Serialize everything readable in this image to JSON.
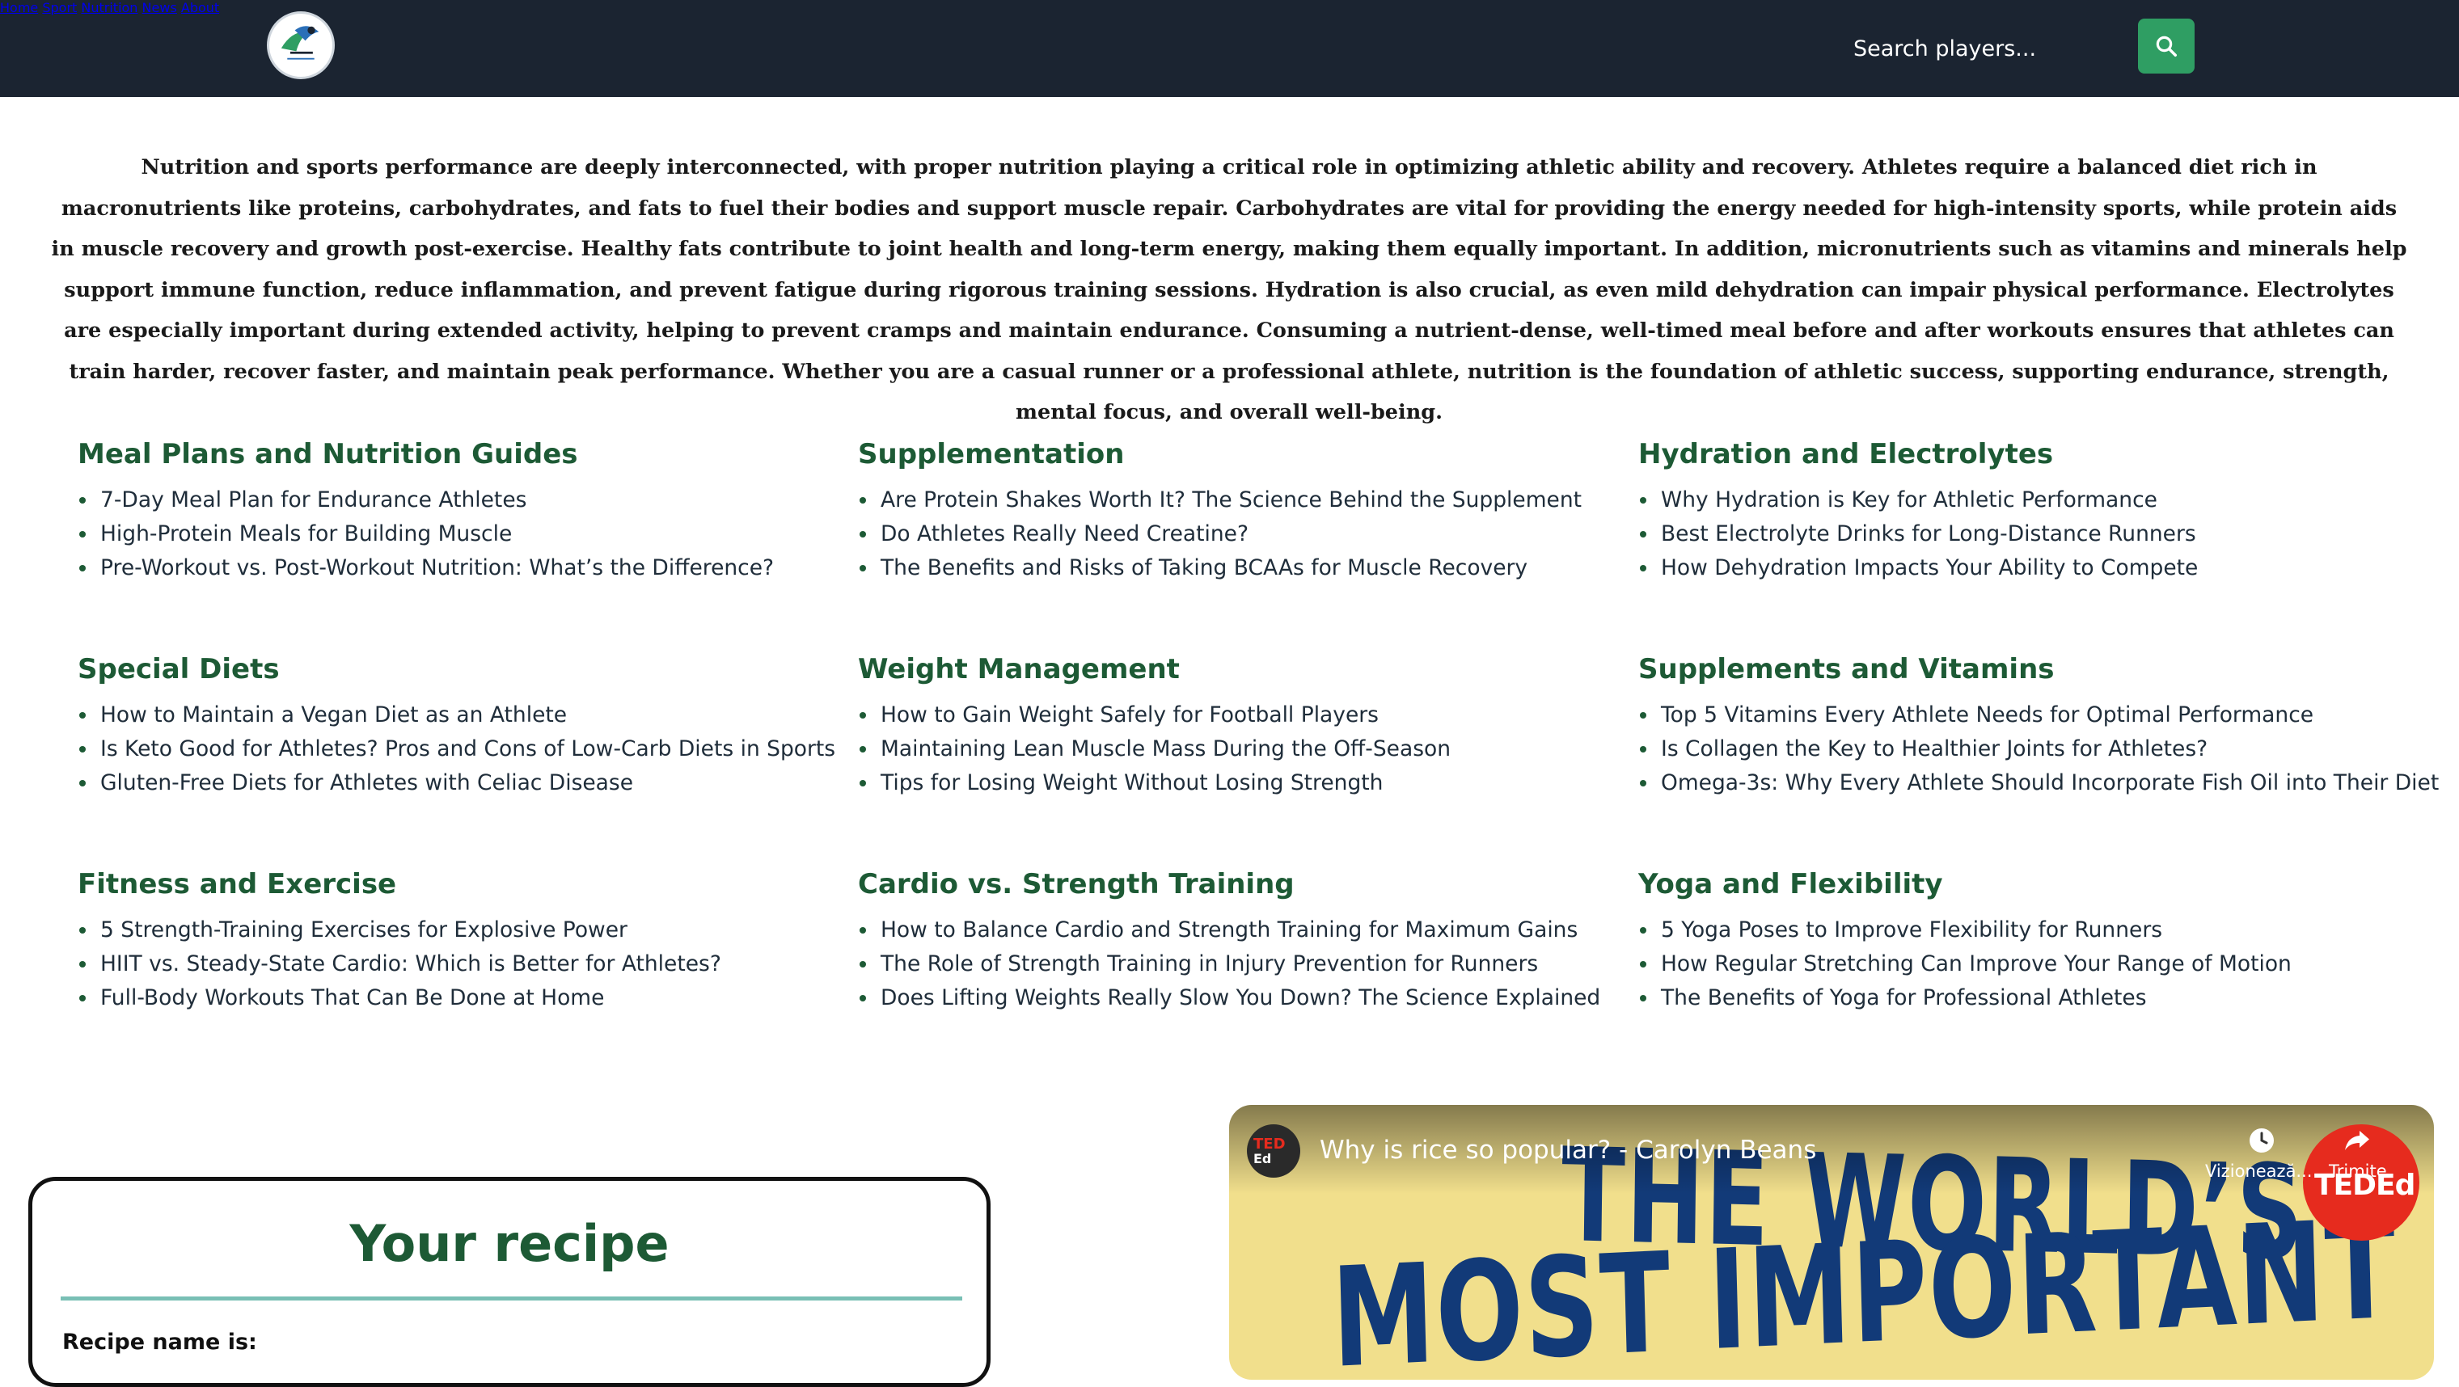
{
  "nav": {
    "links": [
      "Home",
      "Sport",
      "Nutrition",
      "News",
      "About"
    ],
    "search_placeholder": "Search players...",
    "logo_text": "SPORT & NUTRITION"
  },
  "intro": "Nutrition and sports performance are deeply interconnected, with proper nutrition playing a critical role in optimizing athletic ability and recovery. Athletes require a balanced diet rich in macronutrients like proteins, carbohydrates, and fats to fuel their bodies and support muscle repair. Carbohydrates are vital for providing the energy needed for high-intensity sports, while protein aids in muscle recovery and growth post-exercise. Healthy fats contribute to joint health and long-term energy, making them equally important. In addition, micronutrients such as vitamins and minerals help support immune function, reduce inflammation, and prevent fatigue during rigorous training sessions. Hydration is also crucial, as even mild dehydration can impair physical performance. Electrolytes are especially important during extended activity, helping to prevent cramps and maintain endurance. Consuming a nutrient-dense, well-timed meal before and after workouts ensures that athletes can train harder, recover faster, and maintain peak performance. Whether you are a casual runner or a professional athlete, nutrition is the foundation of athletic success, supporting endurance, strength, mental focus, and overall well-being.",
  "categories": [
    {
      "title": "Meal Plans and Nutrition Guides",
      "items": [
        "7-Day Meal Plan for Endurance Athletes",
        "High-Protein Meals for Building Muscle",
        "Pre-Workout vs. Post-Workout Nutrition: What’s the Difference?"
      ]
    },
    {
      "title": "Supplementation",
      "items": [
        "Are Protein Shakes Worth It? The Science Behind the Supplement",
        "Do Athletes Really Need Creatine?",
        "The Benefits and Risks of Taking BCAAs for Muscle Recovery"
      ]
    },
    {
      "title": "Hydration and Electrolytes",
      "items": [
        "Why Hydration is Key for Athletic Performance",
        "Best Electrolyte Drinks for Long-Distance Runners",
        "How Dehydration Impacts Your Ability to Compete"
      ]
    },
    {
      "title": "Special Diets",
      "items": [
        "How to Maintain a Vegan Diet as an Athlete",
        "Is Keto Good for Athletes? Pros and Cons of Low-Carb Diets in Sports",
        "Gluten-Free Diets for Athletes with Celiac Disease"
      ]
    },
    {
      "title": "Weight Management",
      "items": [
        "How to Gain Weight Safely for Football Players",
        "Maintaining Lean Muscle Mass During the Off-Season",
        "Tips for Losing Weight Without Losing Strength"
      ]
    },
    {
      "title": "Supplements and Vitamins",
      "items": [
        "Top 5 Vitamins Every Athlete Needs for Optimal Performance",
        "Is Collagen the Key to Healthier Joints for Athletes?",
        "Omega-3s: Why Every Athlete Should Incorporate Fish Oil into Their Diet"
      ]
    },
    {
      "title": "Fitness and Exercise",
      "items": [
        "5 Strength-Training Exercises for Explosive Power",
        "HIIT vs. Steady-State Cardio: Which is Better for Athletes?",
        "Full-Body Workouts That Can Be Done at Home"
      ]
    },
    {
      "title": "Cardio vs. Strength Training",
      "items": [
        "How to Balance Cardio and Strength Training for Maximum Gains",
        "The Role of Strength Training in Injury Prevention for Runners",
        "Does Lifting Weights Really Slow You Down? The Science Explained"
      ]
    },
    {
      "title": "Yoga and Flexibility",
      "items": [
        "5 Yoga Poses to Improve Flexibility for Runners",
        "How Regular Stretching Can Improve Your Range of Motion",
        "The Benefits of Yoga for Professional Athletes"
      ]
    }
  ],
  "recipe": {
    "title": "Your recipe",
    "name_label": "Recipe name is:"
  },
  "video": {
    "title": "Why is rice so popular? - Carolyn Beans",
    "channel_top": "TED",
    "channel_bottom": "Ed",
    "watch_later": "Vizionează...",
    "share": "Trimite",
    "thumb_line1": "THE WORLD’S",
    "thumb_line2": "MOST IMPORTANT FOOD",
    "badge": "TEDEd"
  },
  "colors": {
    "header_bg": "#1b2431",
    "accent_green": "#2f9e63",
    "heading_green": "#1d5a35",
    "ted_red": "#e62b1e"
  }
}
